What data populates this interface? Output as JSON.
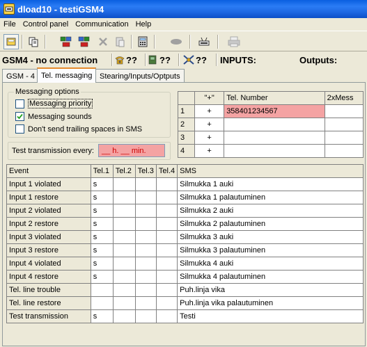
{
  "window": {
    "title": "dload10 - testiGSM4"
  },
  "menu": [
    "File",
    "Control panel",
    "Communication",
    "Help"
  ],
  "status": {
    "connection": "GSM4 - no connection",
    "phone_value": "??",
    "signal_value": "??",
    "satellite_value": "??",
    "inputs_label": "INPUTS:",
    "outputs_label": "Outputs:"
  },
  "tabs": [
    "GSM - 4",
    "Tel. messaging",
    "Stearing/Inputs/Optputs"
  ],
  "messaging_options": {
    "title": "Messaging options",
    "items": [
      {
        "label": "Messaging priority",
        "checked": false
      },
      {
        "label": "Messaging sounds",
        "checked": true
      },
      {
        "label": "Don't send trailing spaces in SMS",
        "checked": false
      }
    ]
  },
  "test_transmission": {
    "label": "Test transmission every:",
    "value": "__ h. __ min."
  },
  "phone_table": {
    "headers": [
      "",
      "\"+\"",
      "Tel. Number",
      "2xMess"
    ],
    "rows": [
      {
        "num": "1",
        "plus": "+",
        "number": "358401234567",
        "double": ""
      },
      {
        "num": "2",
        "plus": "+",
        "number": "",
        "double": ""
      },
      {
        "num": "3",
        "plus": "+",
        "number": "",
        "double": ""
      },
      {
        "num": "4",
        "plus": "+",
        "number": "",
        "double": ""
      }
    ]
  },
  "event_table": {
    "headers": [
      "Event",
      "Tel.1",
      "Tel.2",
      "Tel.3",
      "Tel.4",
      "SMS"
    ],
    "rows": [
      {
        "event": "Input 1 violated",
        "t1": "s",
        "t2": "",
        "t3": "",
        "t4": "",
        "sms": "Silmukka 1 auki"
      },
      {
        "event": "Input 1 restore",
        "t1": "s",
        "t2": "",
        "t3": "",
        "t4": "",
        "sms": "Silmukka 1 palautuminen"
      },
      {
        "event": "Input 2 violated",
        "t1": "s",
        "t2": "",
        "t3": "",
        "t4": "",
        "sms": "Silmukka 2 auki"
      },
      {
        "event": "Input 2 restore",
        "t1": "s",
        "t2": "",
        "t3": "",
        "t4": "",
        "sms": "Silmukka 2 palautuminen"
      },
      {
        "event": "Input 3 violated",
        "t1": "s",
        "t2": "",
        "t3": "",
        "t4": "",
        "sms": "Silmukka 3 auki"
      },
      {
        "event": "Input 3 restore",
        "t1": "s",
        "t2": "",
        "t3": "",
        "t4": "",
        "sms": "Silmukka 3 palautuminen"
      },
      {
        "event": "Input 4 violated",
        "t1": "s",
        "t2": "",
        "t3": "",
        "t4": "",
        "sms": "Silmukka 4 auki"
      },
      {
        "event": "Input 4 restore",
        "t1": "s",
        "t2": "",
        "t3": "",
        "t4": "",
        "sms": "Silmukka 4 palautuminen"
      },
      {
        "event": "Tel. line trouble",
        "t1": "",
        "t2": "",
        "t3": "",
        "t4": "",
        "sms": "Puh.linja vika"
      },
      {
        "event": "Tel. line restore",
        "t1": "",
        "t2": "",
        "t3": "",
        "t4": "",
        "sms": "Puh.linja vika palautuminen"
      },
      {
        "event": "Test transmission",
        "t1": "s",
        "t2": "",
        "t3": "",
        "t4": "",
        "sms": "Testi"
      }
    ]
  },
  "icons": {
    "app": "app-icon",
    "toolbar": [
      "open-icon",
      "copy-icon",
      "read-device-icon",
      "write-device-icon",
      "delete-icon",
      "paste-icon",
      "calculator-icon",
      "disconnect-icon",
      "modem-icon",
      "print-icon"
    ],
    "status": [
      "phone-icon",
      "signal-icon",
      "satellite-icon"
    ]
  },
  "colors": {
    "highlight_field": "#f4a3a3",
    "titlebar": "#0a5fe0",
    "active_tab_accent": "#e68b2c"
  }
}
